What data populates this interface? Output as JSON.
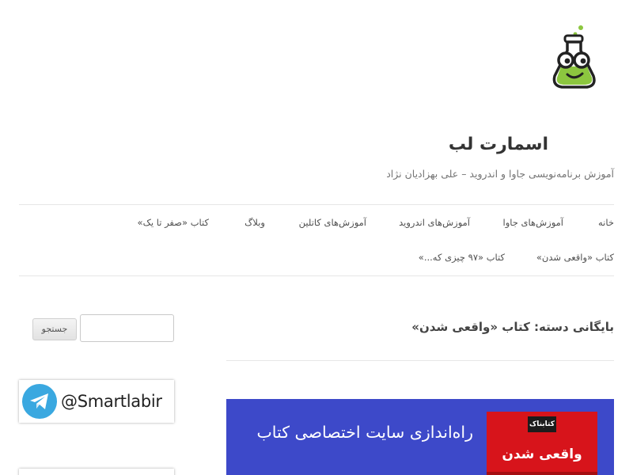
{
  "site": {
    "title": "اسمارت لب",
    "tagline": "آموزش برنامه‌نویسی جاوا و اندروید – علی بهزادیان نژاد",
    "logo_icon": "flask-mascot-icon"
  },
  "nav": {
    "row1": [
      "خانه",
      "آموزش‌های جاوا",
      "آموزش‌های اندروید",
      "آموزش‌های کاتلین",
      "وبلاگ",
      "کتاب «صفر تا یک»"
    ],
    "row2": [
      "کتاب «واقعی شدن»",
      "کتاب «۹۷ چیزی که...»"
    ]
  },
  "main": {
    "archive_title": "بایگانی دسته: کتاب «واقعی شدن»",
    "banner": {
      "text": "راه‌اندازی سایت اختصاصی کتاب",
      "badge": "کتابناک",
      "book_title": "واقعی شدن",
      "bg_color": "#3d49c9",
      "book_color": "#d7141b"
    }
  },
  "sidebar": {
    "search": {
      "button_label": "جستجو",
      "value": "",
      "placeholder": ""
    },
    "telegram": {
      "handle": "@Smartlabir",
      "icon": "telegram-icon",
      "color": "#3aa8e0"
    }
  }
}
